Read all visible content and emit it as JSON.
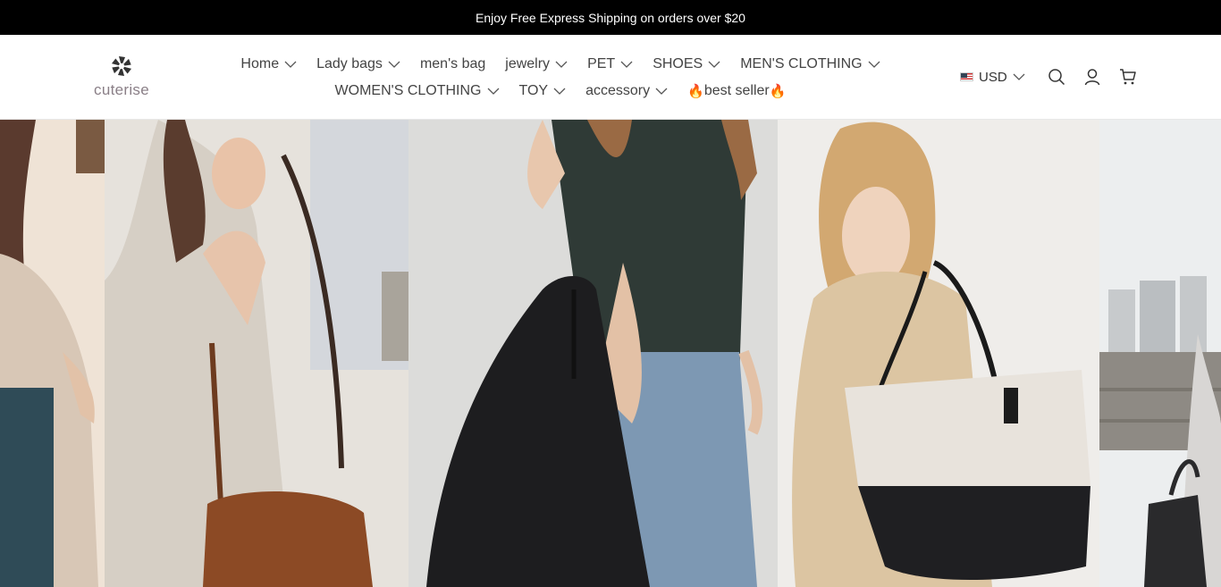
{
  "announcement": {
    "text": "Enjoy Free Express Shipping on orders over $20"
  },
  "brand": {
    "name": "cuterise"
  },
  "nav": {
    "row1": [
      {
        "label": "Home",
        "has_dropdown": true
      },
      {
        "label": "Lady bags",
        "has_dropdown": true
      },
      {
        "label": "men's bag",
        "has_dropdown": false
      },
      {
        "label": "jewelry",
        "has_dropdown": true
      },
      {
        "label": "PET",
        "has_dropdown": true
      },
      {
        "label": "SHOES",
        "has_dropdown": true
      },
      {
        "label": "MEN'S CLOTHING",
        "has_dropdown": true
      }
    ],
    "row2": [
      {
        "label": "WOMEN'S CLOTHING",
        "has_dropdown": true
      },
      {
        "label": "TOY",
        "has_dropdown": true
      },
      {
        "label": "accessory",
        "has_dropdown": true
      },
      {
        "label": "best seller",
        "has_dropdown": false,
        "decoration": "fire-icon"
      }
    ]
  },
  "tools": {
    "currency": "USD",
    "icons": [
      "search-icon",
      "account-icon",
      "cart-icon"
    ]
  },
  "colors": {
    "announcement_bg": "#000000",
    "announcement_text": "#ffffff",
    "brand_text": "#8a7f87",
    "nav_text": "#444444"
  },
  "hero": {
    "panels": [
      "woman-satin-blouse-photo",
      "woman-brown-bucket-bag-photo",
      "woman-black-leather-tote-photo",
      "woman-beige-tote-photo",
      "woman-black-tote-city-photo"
    ]
  }
}
